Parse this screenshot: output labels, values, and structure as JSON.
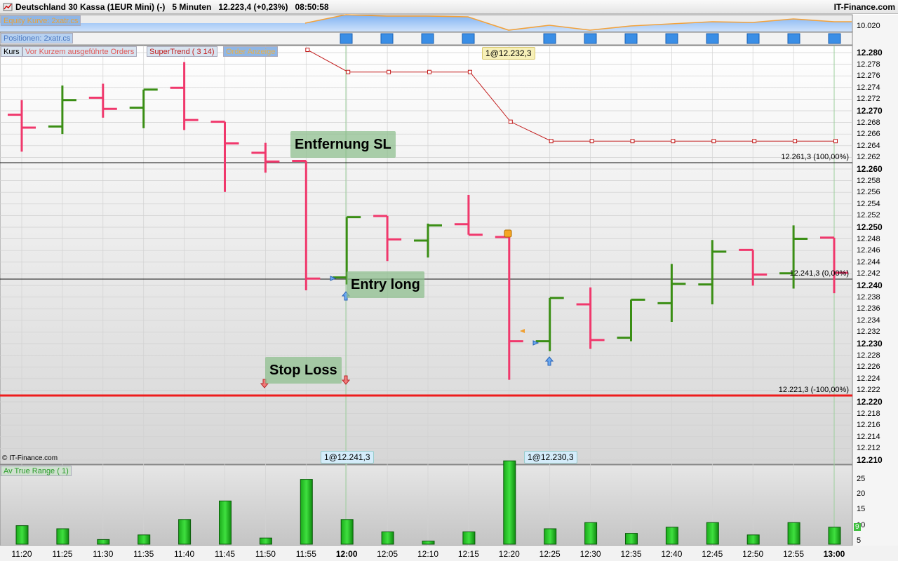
{
  "titlebar": {
    "instrument": "Deutschland 30 Kassa (1EUR Mini) (-)",
    "timeframe": "5 Minuten",
    "price": "12.223,4 (+0,23%)",
    "time": "08:50:58",
    "brand": "IT-Finance.com"
  },
  "equity_panel": {
    "label": "Equity Kurve: 2xatr.cs",
    "price_label": "10.020"
  },
  "positions_panel": {
    "label": "Positionen: 2xatr.cs"
  },
  "main_panel": {
    "legend": [
      "Kurs",
      "Vor Kurzem ausgeführte Orders",
      "SuperTrend ( 3 14)",
      "Order Anzeige"
    ],
    "watermark": "© IT-Finance.com",
    "annotations": {
      "entfernung": "Entfernung SL",
      "entry": "Entry long",
      "stoploss": "Stop Loss"
    },
    "order_chips": {
      "top": "1@12.232,3",
      "entry": "1@12.241,3",
      "exit": "1@12.230,3"
    },
    "levels": {
      "l100": "12.261,3 (100,00%)",
      "l0": "12.241,3 (0,00%)",
      "lm100": "12.221,3 (-100,00%)"
    },
    "y_ticks": [
      "12.280",
      "12.278",
      "12.276",
      "12.274",
      "12.272",
      "12.270",
      "12.268",
      "12.266",
      "12.264",
      "12.262",
      "12.260",
      "12.258",
      "12.256",
      "12.254",
      "12.252",
      "12.250",
      "12.248",
      "12.246",
      "12.244",
      "12.242",
      "12.240",
      "12.238",
      "12.236",
      "12.234",
      "12.232",
      "12.230",
      "12.228",
      "12.226",
      "12.224",
      "12.222",
      "12.220",
      "12.218",
      "12.216",
      "12.214",
      "12.212",
      "12.210"
    ]
  },
  "atr_panel": {
    "label": "Av True Range ( 1)",
    "y_ticks": [
      "25",
      "20",
      "15",
      "10",
      "5"
    ],
    "last_value": "9",
    "values": [
      6,
      5,
      1.5,
      3,
      8,
      14,
      2,
      21,
      8,
      4,
      1,
      4,
      27,
      5,
      7,
      3.5,
      5.5,
      7,
      3,
      7,
      5.5
    ]
  },
  "x_axis": {
    "labels": [
      "11:20",
      "11:25",
      "11:30",
      "11:35",
      "11:40",
      "11:45",
      "11:50",
      "11:55",
      "12:00",
      "12:05",
      "12:10",
      "12:15",
      "12:20",
      "12:25",
      "12:30",
      "12:35",
      "12:40",
      "12:45",
      "12:50",
      "12:55",
      "13:00"
    ]
  },
  "chart_data": {
    "type": "ohlc",
    "x": [
      "11:20",
      "11:25",
      "11:30",
      "11:35",
      "11:40",
      "11:45",
      "11:50",
      "11:55",
      "12:00",
      "12:05",
      "12:10",
      "12:15",
      "12:20",
      "12:25",
      "12:30",
      "12:35",
      "12:40",
      "12:45",
      "12:50",
      "12:55",
      "13:00"
    ],
    "bars": [
      {
        "o": 12268.9,
        "h": 12271.4,
        "l": 12262.6,
        "c": 12266.7
      },
      {
        "o": 12266.9,
        "h": 12273.9,
        "l": 12265.6,
        "c": 12271.4
      },
      {
        "o": 12271.8,
        "h": 12274.2,
        "l": 12268.4,
        "c": 12269.9
      },
      {
        "o": 12270.1,
        "h": 12273.2,
        "l": 12266.6,
        "c": 12273.2
      },
      {
        "o": 12273.5,
        "h": 12277.9,
        "l": 12266.3,
        "c": 12268.0
      },
      {
        "o": 12267.7,
        "h": 12267.7,
        "l": 12255.7,
        "c": 12264.0
      },
      {
        "o": 12262.4,
        "h": 12264.1,
        "l": 12259.0,
        "c": 12260.9
      },
      {
        "o": 12261.0,
        "h": 12261.0,
        "l": 12238.9,
        "c": 12240.9
      },
      {
        "o": 12241.1,
        "h": 12251.4,
        "l": 12239.9,
        "c": 12251.4
      },
      {
        "o": 12251.6,
        "h": 12251.6,
        "l": 12243.9,
        "c": 12247.6
      },
      {
        "o": 12247.4,
        "h": 12250.3,
        "l": 12244.5,
        "c": 12250.0
      },
      {
        "o": 12250.2,
        "h": 12255.2,
        "l": 12248.4,
        "c": 12248.4
      },
      {
        "o": 12248.0,
        "h": 12248.0,
        "l": 12223.6,
        "c": 12230.2
      },
      {
        "o": 12230.2,
        "h": 12237.6,
        "l": 12228.5,
        "c": 12237.6
      },
      {
        "o": 12236.5,
        "h": 12239.4,
        "l": 12228.9,
        "c": 12230.4
      },
      {
        "o": 12230.8,
        "h": 12237.3,
        "l": 12230.2,
        "c": 12237.3
      },
      {
        "o": 12236.7,
        "h": 12243.4,
        "l": 12233.5,
        "c": 12240.0
      },
      {
        "o": 12239.9,
        "h": 12247.5,
        "l": 12236.5,
        "c": 12245.5
      },
      {
        "o": 12245.8,
        "h": 12245.8,
        "l": 12239.7,
        "c": 12241.6
      },
      {
        "o": 12241.8,
        "h": 12250.0,
        "l": 12239.2,
        "c": 12247.7
      },
      {
        "o": 12247.9,
        "h": 12247.9,
        "l": 12238.4,
        "c": 12241.9
      }
    ],
    "supertrend": [
      null,
      null,
      null,
      null,
      null,
      null,
      null,
      12280.0,
      12276.2,
      12276.2,
      12276.2,
      12276.2,
      12267.7,
      12264.4,
      12264.4,
      12264.4,
      12264.4,
      12264.4,
      12264.4,
      12264.4,
      12264.4
    ],
    "ylim": [
      12209.3,
      12280.6
    ],
    "colors": {
      "up": "#3a8e14",
      "down": "#f0386c",
      "supertrend": "#c21c1c",
      "stoploss": "#ee1c1c"
    }
  }
}
